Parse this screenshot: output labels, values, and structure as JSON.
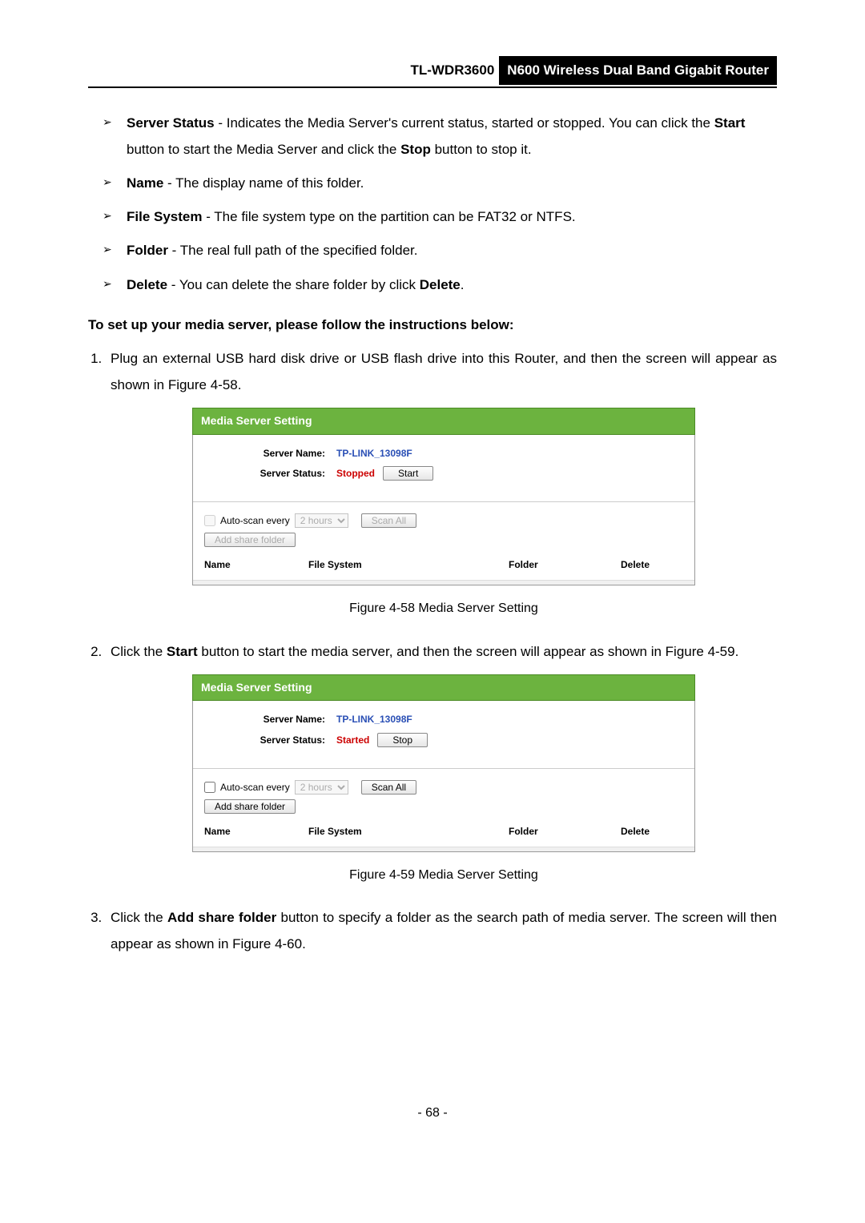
{
  "header": {
    "model": "TL-WDR3600",
    "product": "N600 Wireless Dual Band Gigabit Router"
  },
  "bullets": [
    {
      "term": "Server Status",
      "text": " - Indicates the Media Server's current status, started or stopped. You can click the ",
      "bold2": "Start",
      "text2": " button to start the Media Server and click the ",
      "bold3": "Stop",
      "text3": " button to stop it."
    },
    {
      "term": "Name",
      "text": " - The display name of this folder."
    },
    {
      "term": "File System",
      "text": " - The file system type on the partition can be FAT32 or NTFS."
    },
    {
      "term": "Folder",
      "text": " - The real full path of the specified folder."
    },
    {
      "term": "Delete",
      "text": " - You can delete the share folder by click ",
      "bold2": "Delete",
      "text2": "."
    }
  ],
  "heading": "To set up your media server, please follow the instructions below:",
  "steps": [
    {
      "pre": "Plug an external USB hard disk drive or USB flash drive into this Router, and then the screen will appear as shown in Figure 4-58."
    },
    {
      "pre": "Click the ",
      "b": "Start",
      "post": " button to start the media server, and then the screen will appear as shown in Figure 4-59."
    },
    {
      "pre": "Click the ",
      "b": "Add share folder",
      "post": " button to specify a folder as the search path of media server. The screen will then appear as shown in Figure 4-60."
    }
  ],
  "captions": {
    "fig58": "Figure 4-58 Media Server Setting",
    "fig59": "Figure 4-59 Media Server Setting"
  },
  "panel": {
    "title": "Media Server Setting",
    "serverNameLabel": "Server Name:",
    "serverName": "TP-LINK_13098F",
    "serverStatusLabel": "Server Status:",
    "stopped": "Stopped",
    "started": "Started",
    "startBtn": "Start",
    "stopBtn": "Stop",
    "autoScanLabel": "Auto-scan every",
    "scanOption": "2 hours",
    "scanAllBtn": "Scan All",
    "addFolderBtn": "Add share folder",
    "th": {
      "name": "Name",
      "fs": "File System",
      "folder": "Folder",
      "del": "Delete"
    }
  },
  "pageNum": "- 68 -"
}
